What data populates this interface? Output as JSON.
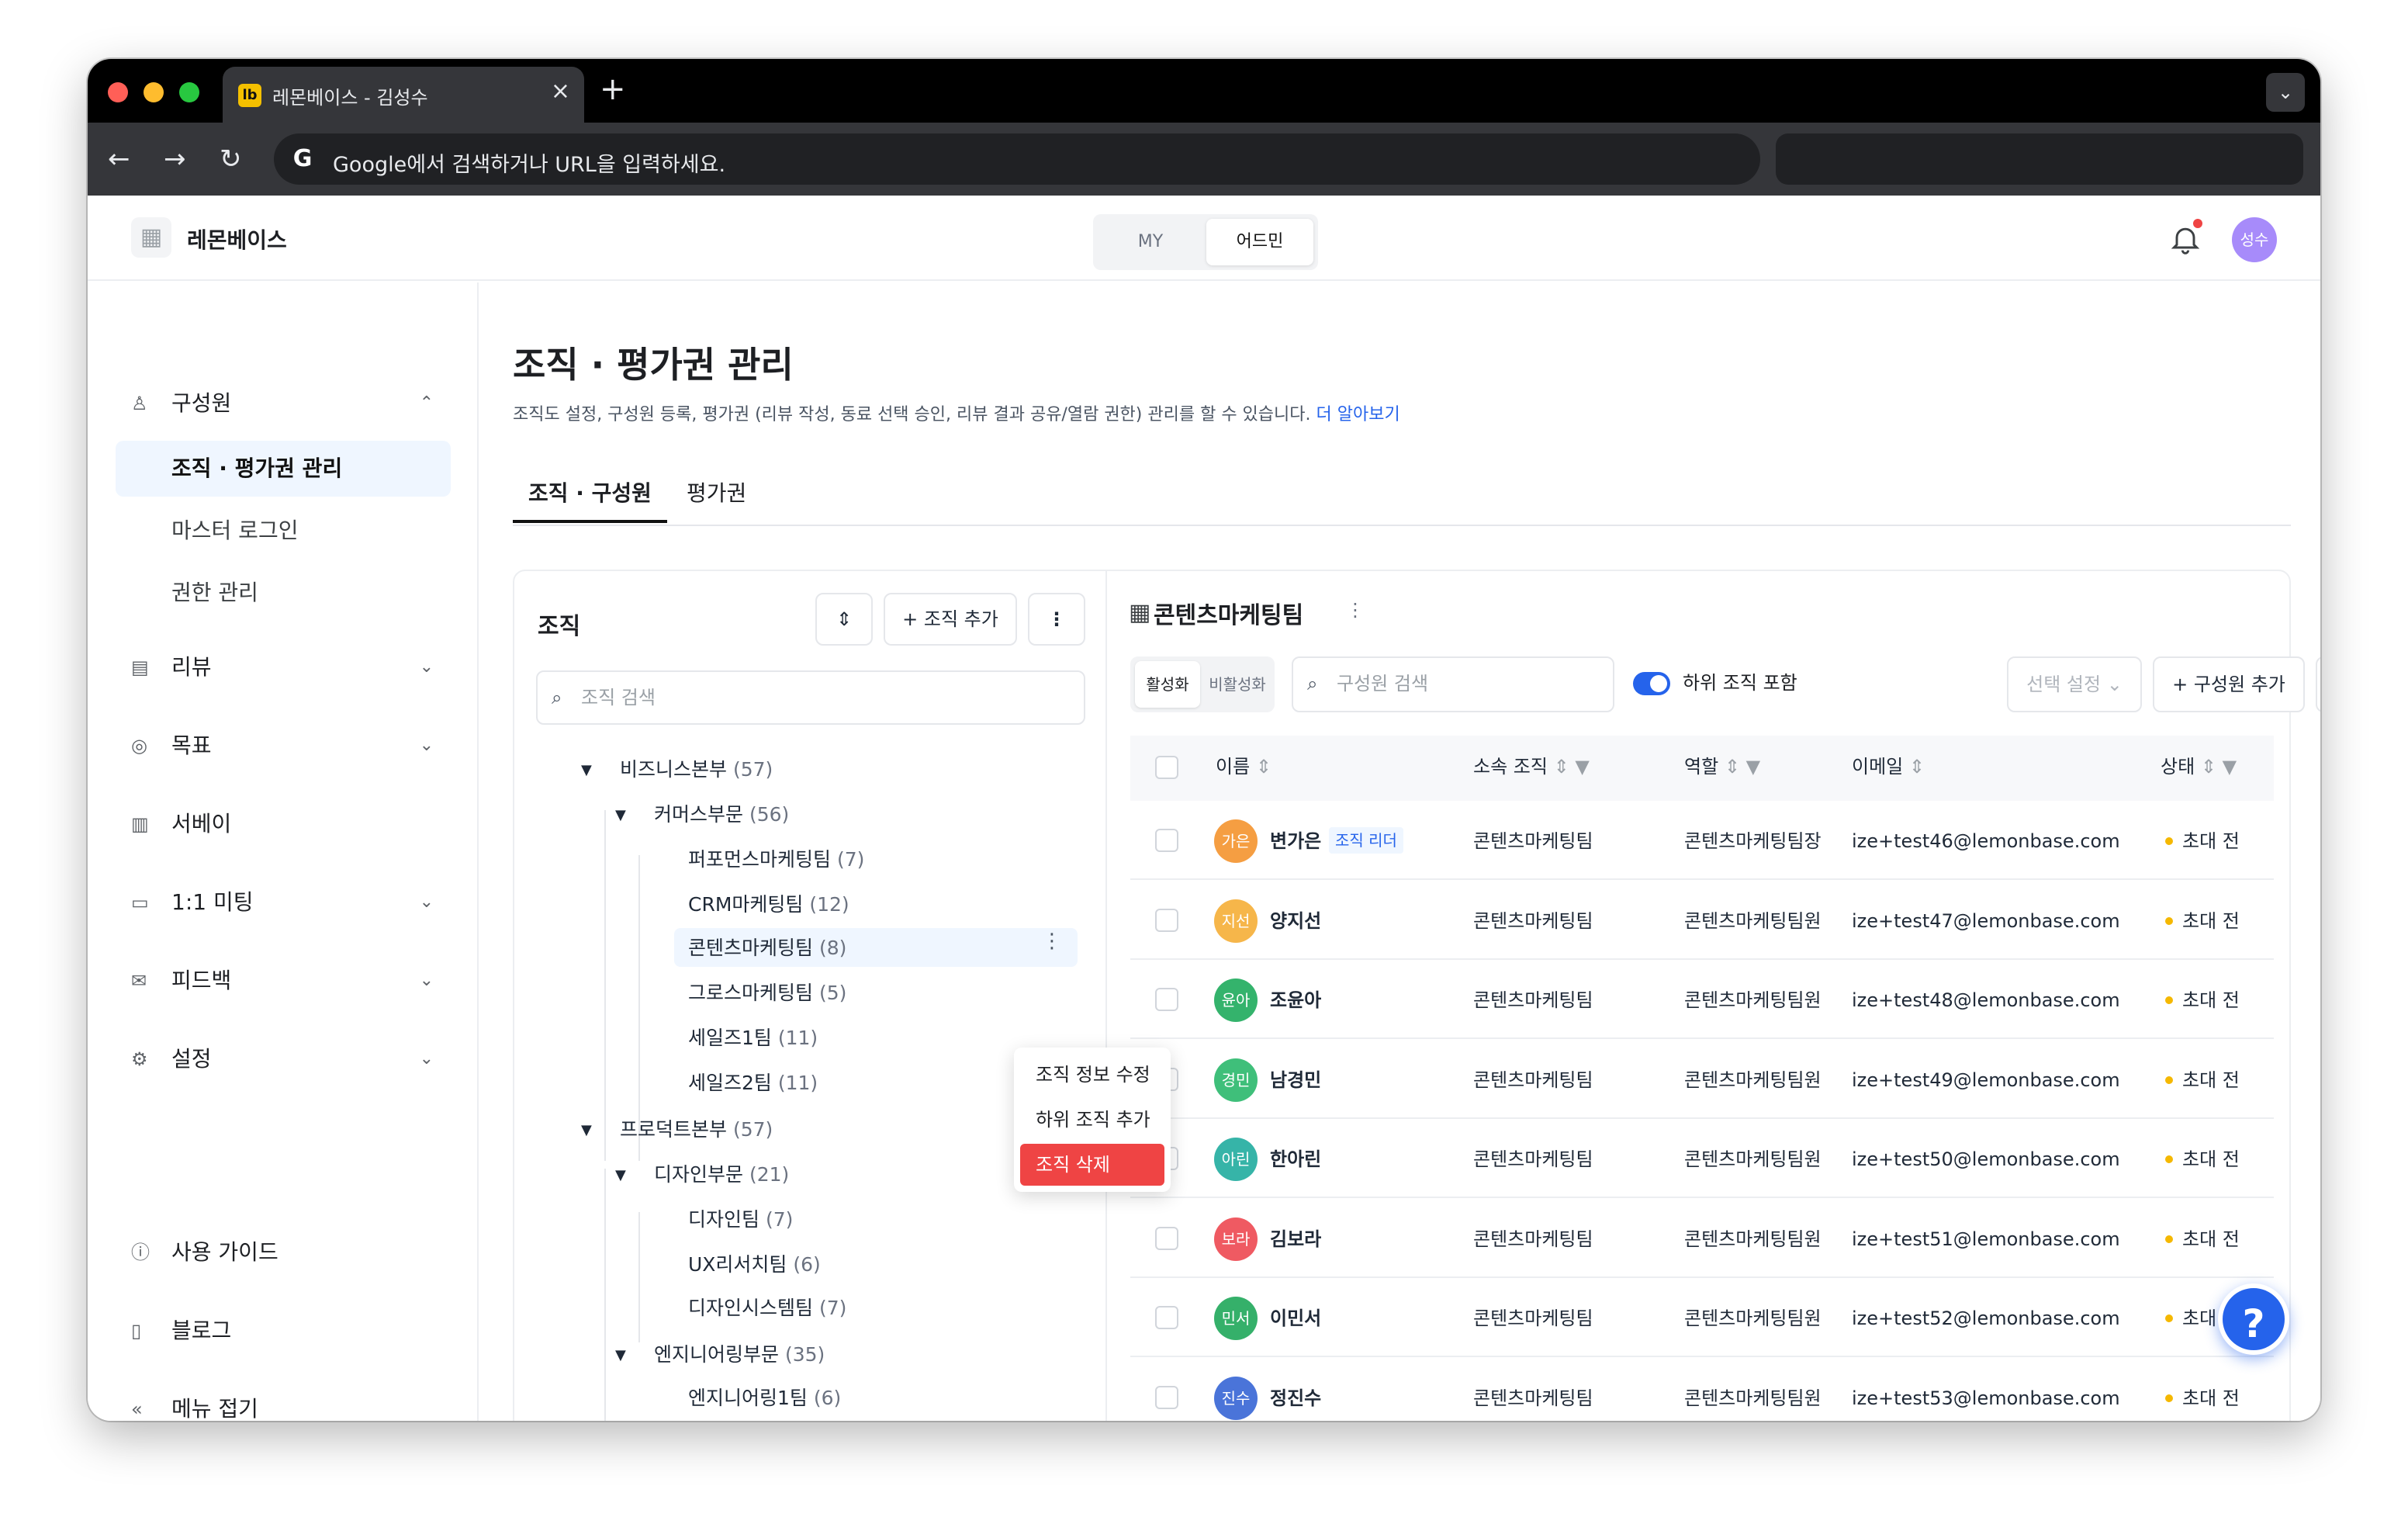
{
  "browser": {
    "tab_title": "레몬베이스 - 김성수",
    "favicon": "lb",
    "omnibox_placeholder": "Google에서 검색하거나 URL을 입력하세요."
  },
  "header": {
    "brand": "레몬베이스",
    "mode_my": "MY",
    "mode_admin": "어드민",
    "avatar": "성수"
  },
  "sidebar": {
    "members": "구성원",
    "sub": [
      "조직 · 평가권 관리",
      "마스터 로그인",
      "권한 관리"
    ],
    "items": [
      "리뷰",
      "목표",
      "서베이",
      "1:1 미팅",
      "피드백",
      "설정"
    ],
    "bottom": [
      "사용 가이드",
      "블로그",
      "메뉴 접기"
    ]
  },
  "page": {
    "title": "조직 · 평가권 관리",
    "description": "조직도 설정, 구성원 등록, 평가권 (리뷰 작성, 동료 선택 승인, 리뷰 결과 공유/열람 권한) 관리를 할 수 있습니다.",
    "learn_more": "더 알아보기",
    "tabs": [
      "조직 · 구성원",
      "평가권"
    ]
  },
  "org": {
    "title": "조직",
    "add_button": "+ 조직 추가",
    "search_placeholder": "조직 검색",
    "tree": [
      {
        "name": "비즈니스본부",
        "count": "(57)"
      },
      {
        "name": "커머스부문",
        "count": "(56)"
      },
      {
        "name": "퍼포먼스마케팅팀",
        "count": "(7)"
      },
      {
        "name": "CRM마케팅팀",
        "count": "(12)"
      },
      {
        "name": "콘텐츠마케팅팀",
        "count": "(8)"
      },
      {
        "name": "그로스마케팅팀",
        "count": "(5)"
      },
      {
        "name": "세일즈1팀",
        "count": "(11)"
      },
      {
        "name": "세일즈2팀",
        "count": "(11)"
      },
      {
        "name": "프로덕트본부",
        "count": "(57)"
      },
      {
        "name": "디자인부문",
        "count": "(21)"
      },
      {
        "name": "디자인팀",
        "count": "(7)"
      },
      {
        "name": "UX리서치팀",
        "count": "(6)"
      },
      {
        "name": "디자인시스템팀",
        "count": "(7)"
      },
      {
        "name": "엔지니어링부문",
        "count": "(35)"
      },
      {
        "name": "엔지니어링1팀",
        "count": "(6)"
      }
    ],
    "context_menu": [
      "조직 정보 수정",
      "하위 조직 추가",
      "조직 삭제"
    ]
  },
  "members": {
    "team_title": "콘텐츠마케팅팀",
    "filter_active": "활성화",
    "filter_inactive": "비활성화",
    "search_placeholder": "구성원 검색",
    "include_sub": "하위 조직 포함",
    "select_setting": "선택 설정",
    "add_member": "+ 구성원 추가",
    "columns": [
      "이름",
      "소속 조직",
      "역할",
      "이메일",
      "상태"
    ],
    "leader_badge": "조직 리더",
    "rows": [
      {
        "initials": "가은",
        "name": "변가은",
        "org": "콘텐츠마케팅팀",
        "role": "콘텐츠마케팅팀장",
        "email": "ize+test46@lemonbase.com",
        "status": "초대 전",
        "color": "#f59e42"
      },
      {
        "initials": "지선",
        "name": "양지선",
        "org": "콘텐츠마케팅팀",
        "role": "콘텐츠마케팅팀원",
        "email": "ize+test47@lemonbase.com",
        "status": "초대 전",
        "color": "#f6b64a"
      },
      {
        "initials": "윤아",
        "name": "조윤아",
        "org": "콘텐츠마케팅팀",
        "role": "콘텐츠마케팅팀원",
        "email": "ize+test48@lemonbase.com",
        "status": "초대 전",
        "color": "#34b36c"
      },
      {
        "initials": "경민",
        "name": "남경민",
        "org": "콘텐츠마케팅팀",
        "role": "콘텐츠마케팅팀원",
        "email": "ize+test49@lemonbase.com",
        "status": "초대 전",
        "color": "#3fbf7a"
      },
      {
        "initials": "아린",
        "name": "한아린",
        "org": "콘텐츠마케팅팀",
        "role": "콘텐츠마케팅팀원",
        "email": "ize+test50@lemonbase.com",
        "status": "초대 전",
        "color": "#36b4a8"
      },
      {
        "initials": "보라",
        "name": "김보라",
        "org": "콘텐츠마케팅팀",
        "role": "콘텐츠마케팅팀원",
        "email": "ize+test51@lemonbase.com",
        "status": "초대 전",
        "color": "#ef5a62"
      },
      {
        "initials": "민서",
        "name": "이민서",
        "org": "콘텐츠마케팅팀",
        "role": "콘텐츠마케팅팀원",
        "email": "ize+test52@lemonbase.com",
        "status": "초대 전",
        "color": "#35b06a"
      },
      {
        "initials": "진수",
        "name": "정진수",
        "org": "콘텐츠마케팅팀",
        "role": "콘텐츠마케팅팀원",
        "email": "ize+test53@lemonbase.com",
        "status": "초대 전",
        "color": "#4a74d9"
      }
    ]
  },
  "help": "?"
}
